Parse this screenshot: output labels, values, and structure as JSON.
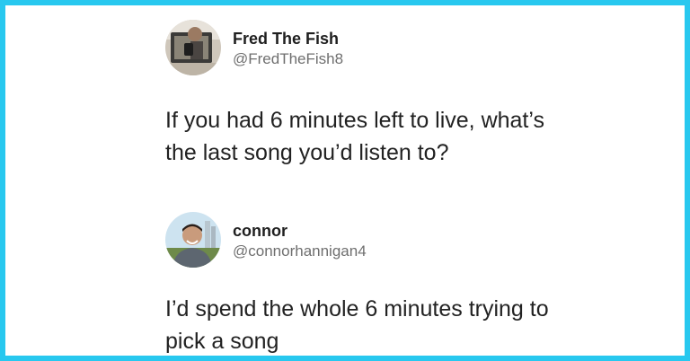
{
  "tweets": [
    {
      "display_name": "Fred The Fish",
      "handle": "@FredTheFish8",
      "text_lines": [
        "If you had 6 minutes left to live, what’s",
        "the last song you’d listen to?"
      ],
      "avatar": "avatar-photo-person-with-phone"
    },
    {
      "display_name": "connor",
      "handle": "@connorhannigan4",
      "text_lines": [
        "I’d spend the whole 6 minutes trying to",
        "pick a song"
      ],
      "avatar": "avatar-photo-smiling-man-outdoors"
    }
  ],
  "colors": {
    "border": "#28c8ef",
    "name": "#1f1f1f",
    "handle": "#6f6f6f",
    "text": "#222222"
  }
}
